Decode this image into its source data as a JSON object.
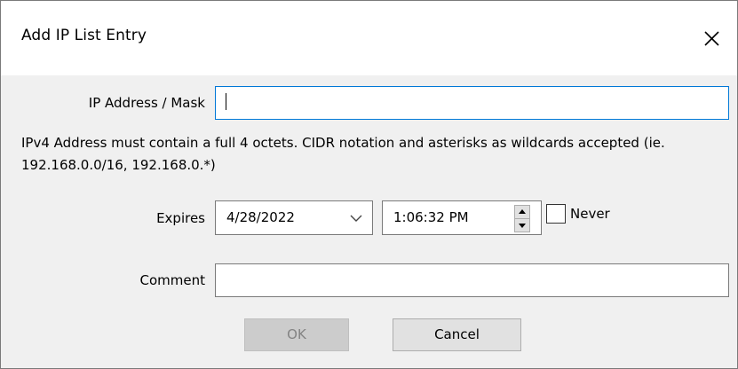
{
  "dialog": {
    "title": "Add IP List Entry",
    "close_icon": "close-icon"
  },
  "ip": {
    "label": "IP Address / Mask",
    "value": ""
  },
  "hint": "IPv4 Address must contain a full 4 octets. CIDR notation and asterisks as wildcards accepted (ie. 192.168.0.0/16, 192.168.0.*)",
  "expires": {
    "label": "Expires",
    "date": "4/28/2022",
    "time": "1:06:32 PM",
    "never_label": "Never",
    "never_checked": false
  },
  "comment": {
    "label": "Comment",
    "value": ""
  },
  "buttons": {
    "ok": "OK",
    "cancel": "Cancel"
  }
}
